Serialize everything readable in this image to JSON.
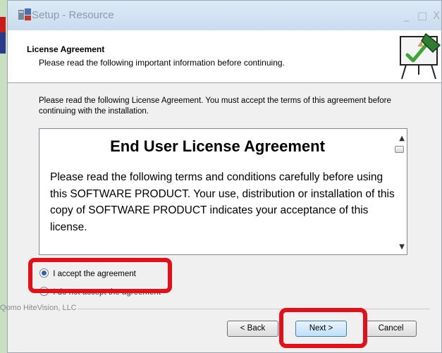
{
  "window": {
    "title": "Setup - Resource",
    "controls": {
      "minimize": "_",
      "maximize": "□",
      "close": "X"
    }
  },
  "header": {
    "title": "License Agreement",
    "subtitle": "Please read the following important information before continuing."
  },
  "intro_text": "Please read the following License Agreement. You must accept the terms of this agreement before continuing with the installation.",
  "license": {
    "heading": "End User License Agreement",
    "body": "Please read the following terms and conditions carefully before using this SOFTWARE PRODUCT.  Your use, distribution or installation of this copy of SOFTWARE PRODUCT indicates your acceptance of this license."
  },
  "options": {
    "accept": "I accept the agreement",
    "decline": "I do not accept the agreement",
    "selected": "accept"
  },
  "company": "Qomo HiteVision, LLC",
  "buttons": {
    "back": "< Back",
    "next": "Next >",
    "cancel": "Cancel"
  },
  "colors": {
    "highlight": "#e3101a",
    "radio_selected": "#2a62b8"
  }
}
